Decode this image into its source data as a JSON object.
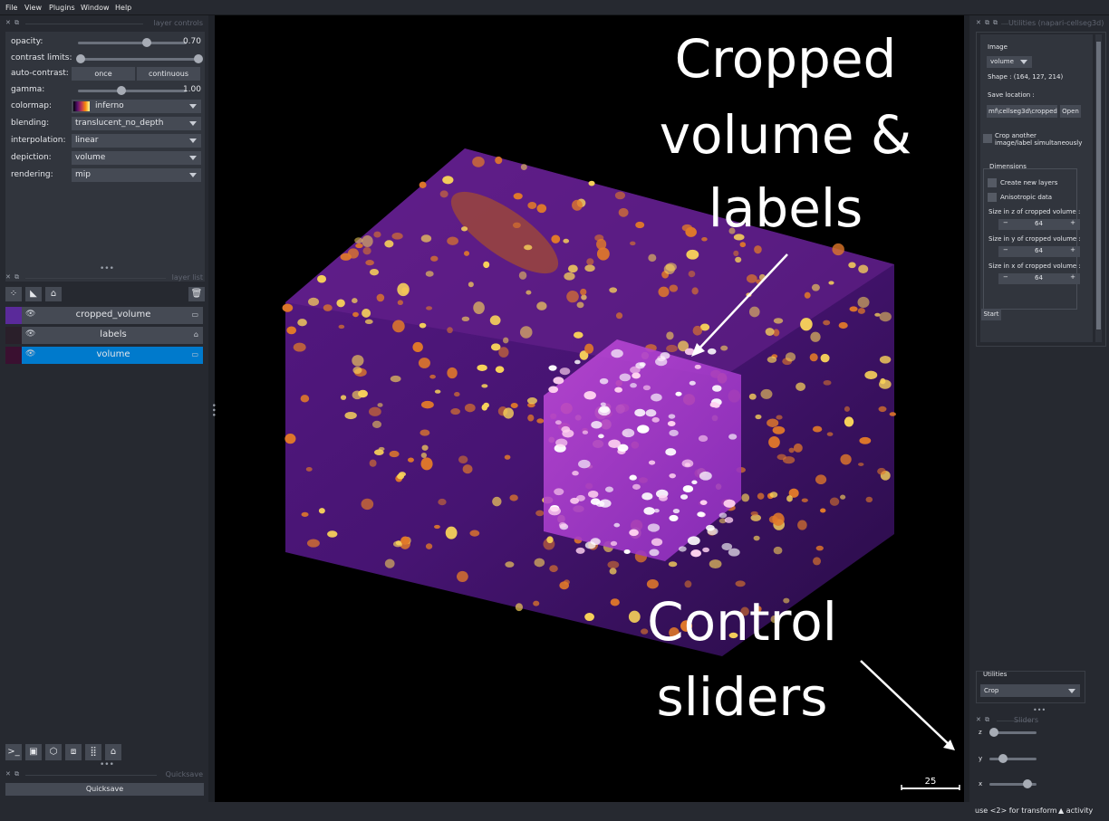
{
  "menu": [
    "File",
    "View",
    "Plugins",
    "Window",
    "Help"
  ],
  "layer_controls": {
    "title": "layer controls",
    "opacity_label": "opacity:",
    "opacity_value": "0.70",
    "opacity_level": 0.63,
    "contrast_label": "contrast limits:",
    "autocontrast_label": "auto-contrast:",
    "once": "once",
    "continuous": "continuous",
    "gamma_label": "gamma:",
    "gamma_value": "1.00",
    "gamma_level": 0.4,
    "colormap_label": "colormap:",
    "colormap_value": "inferno",
    "blending_label": "blending:",
    "blending_value": "translucent_no_depth",
    "interpolation_label": "interpolation:",
    "interpolation_value": "linear",
    "depiction_label": "depiction:",
    "depiction_value": "volume",
    "rendering_label": "rendering:",
    "rendering_value": "mip"
  },
  "layer_list": {
    "title": "layer list",
    "layers": [
      {
        "name": "cropped_volume",
        "type_icon": "image-icon",
        "selected": false
      },
      {
        "name": "labels",
        "type_icon": "label-icon",
        "selected": false
      },
      {
        "name": "volume",
        "type_icon": "image-icon",
        "selected": true
      }
    ]
  },
  "quicksave": {
    "title": "Quicksave",
    "button": "Quicksave"
  },
  "utilities_panel": {
    "title": "Utilities (napari-cellseg3d)",
    "image_label": "Image",
    "image_value": "volume",
    "shape": "Shape : (164, 127, 214)",
    "save_location_label": "Save location :",
    "save_path": "mf\\cellseg3d\\cropped",
    "open": "Open",
    "crop_another": "Crop another",
    "crop_another2": "image/label simultaneously",
    "dimensions": "Dimensions",
    "create_new_layers": "Create new layers",
    "anisotropic": "Anisotropic data",
    "size_z": "Size in z of cropped volume :",
    "size_y": "Size in y of cropped volume :",
    "size_x": "Size in x of cropped volume :",
    "z_val": "64",
    "y_val": "64",
    "x_val": "64",
    "start": "Start"
  },
  "utilities_select": {
    "label": "Utilities",
    "value": "Crop"
  },
  "sliders": {
    "title": "Sliders",
    "z": "z",
    "y": "y",
    "x": "x",
    "z_level": 0.1,
    "y_level": 0.28,
    "x_level": 0.8
  },
  "canvas": {
    "scale_bar": "25"
  },
  "annotations": {
    "top1": "Cropped",
    "top2": "volume &",
    "top3": "labels",
    "bottom1": "Control",
    "bottom2": "sliders"
  },
  "status": {
    "hint": "use <2> for transform",
    "activity": "activity"
  }
}
